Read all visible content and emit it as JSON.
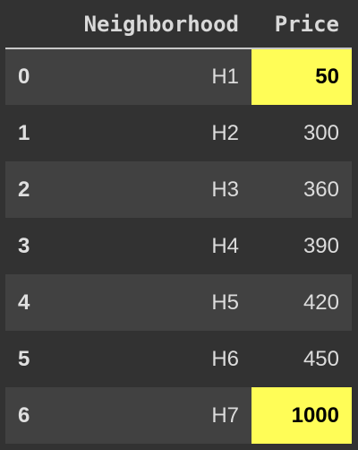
{
  "table": {
    "columns": [
      "",
      "Neighborhood",
      "Price"
    ],
    "rows": [
      {
        "index": "0",
        "neighborhood": "H1",
        "price": "50",
        "highlighted": true
      },
      {
        "index": "1",
        "neighborhood": "H2",
        "price": "300",
        "highlighted": false
      },
      {
        "index": "2",
        "neighborhood": "H3",
        "price": "360",
        "highlighted": false
      },
      {
        "index": "3",
        "neighborhood": "H4",
        "price": "390",
        "highlighted": false
      },
      {
        "index": "4",
        "neighborhood": "H5",
        "price": "420",
        "highlighted": false
      },
      {
        "index": "5",
        "neighborhood": "H6",
        "price": "450",
        "highlighted": false
      },
      {
        "index": "6",
        "neighborhood": "H7",
        "price": "1000",
        "highlighted": true
      }
    ]
  },
  "colors": {
    "background": "#323232",
    "row_alt": "#414141",
    "highlight": "#fffd57"
  }
}
